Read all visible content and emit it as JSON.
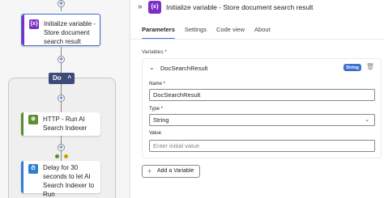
{
  "canvas": {
    "init_card": {
      "icon": "{x}",
      "label": "Initialize variable - Store document search result"
    },
    "scope": {
      "label": "Do",
      "chevron": "^"
    },
    "http_card": {
      "icon": "⊕",
      "label": "HTTP - Run AI Search Indexer"
    },
    "delay_card": {
      "icon": "⏱",
      "label": "Delay for 30 seconds to let AI Search Indexer to Run"
    },
    "add_symbol": "+"
  },
  "panel": {
    "collapse_icon": "»",
    "header_icon": "{x}",
    "title": "Initialize variable - Store document search result",
    "tabs": [
      {
        "label": "Parameters"
      },
      {
        "label": "Settings"
      },
      {
        "label": "Code view"
      },
      {
        "label": "About"
      }
    ],
    "variables_label": "Variables *",
    "variable": {
      "name_header": "DocSearchResult",
      "type_badge": "String",
      "name_label": "Name *",
      "name_value": "DocSearchResult",
      "type_label": "Type *",
      "type_value": "String",
      "value_label": "Value",
      "value_placeholder": "Enter initial value"
    },
    "add_variable_label": "Add a Variable"
  },
  "colors": {
    "accent": "#3a6fd0",
    "variable_purple": "#7b2fc7",
    "http_green": "#5a8f2e",
    "delay_blue": "#2d7fd3",
    "scope_navy": "#3c4b7a"
  }
}
